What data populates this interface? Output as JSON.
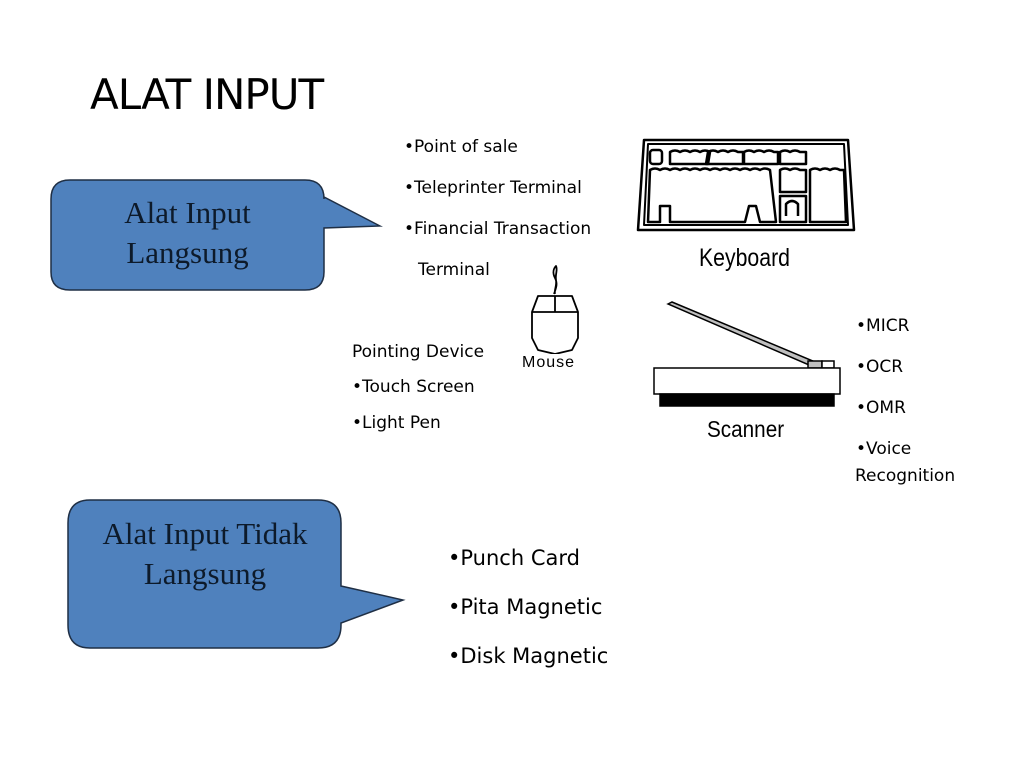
{
  "slide": {
    "title": "ALAT INPUT",
    "accent_color": "#4f81bd"
  },
  "callouts": {
    "direct": {
      "line1": "Alat Input",
      "line2": "Langsung"
    },
    "indirect": {
      "line1": "Alat Input Tidak",
      "line2": "Langsung"
    }
  },
  "direct_list": {
    "items": [
      "•Point of sale",
      "•Teleprinter Terminal",
      "•Financial Transaction",
      "Terminal"
    ]
  },
  "pointing": {
    "heading": "Pointing Device",
    "items": [
      "•Touch Screen",
      "•Light Pen"
    ]
  },
  "scanner_list": {
    "items": [
      "•MICR",
      "•OCR",
      "•OMR",
      "•Voice",
      "Recognition"
    ]
  },
  "indirect_list": {
    "items": [
      "•Punch Card",
      "•Pita Magnetic",
      "•Disk Magnetic"
    ]
  },
  "illustrations": {
    "keyboard": {
      "icon": "keyboard-icon",
      "caption": "Keyboard"
    },
    "mouse": {
      "icon": "mouse-icon",
      "caption": "Mouse"
    },
    "scanner": {
      "icon": "scanner-icon",
      "caption": "Scanner"
    }
  }
}
